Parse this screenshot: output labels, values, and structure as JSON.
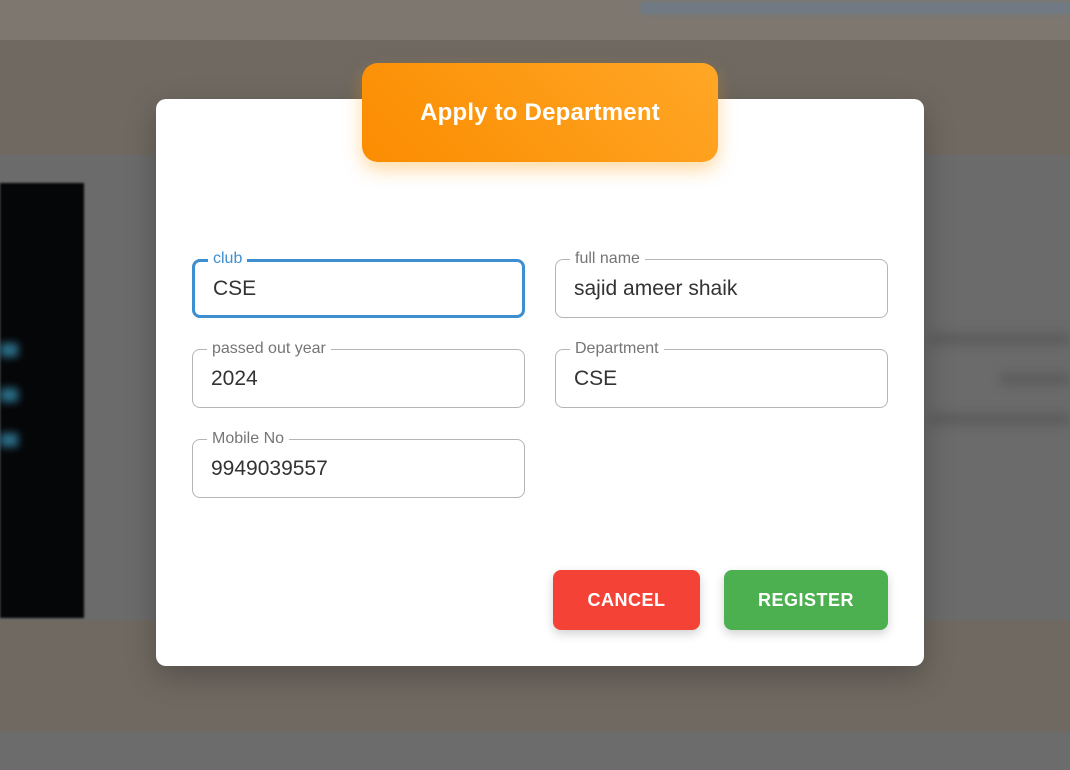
{
  "dialog": {
    "title": "Apply to Department"
  },
  "fields": {
    "club": {
      "label": "club",
      "value": "CSE"
    },
    "full_name": {
      "label": "full name",
      "value": "sajid ameer shaik"
    },
    "passed_out_year": {
      "label": "passed out year",
      "value": "2024"
    },
    "department": {
      "label": "Department",
      "value": "CSE"
    },
    "mobile": {
      "label": "Mobile No",
      "value": "9949039557"
    }
  },
  "actions": {
    "cancel_label": "CANCEL",
    "register_label": "REGISTER"
  },
  "colors": {
    "header_gradient_start": "#fb8c00",
    "header_gradient_end": "#ffa726",
    "focus_blue": "#3d8fd1",
    "cancel_red": "#f44336",
    "register_green": "#4caf50"
  }
}
